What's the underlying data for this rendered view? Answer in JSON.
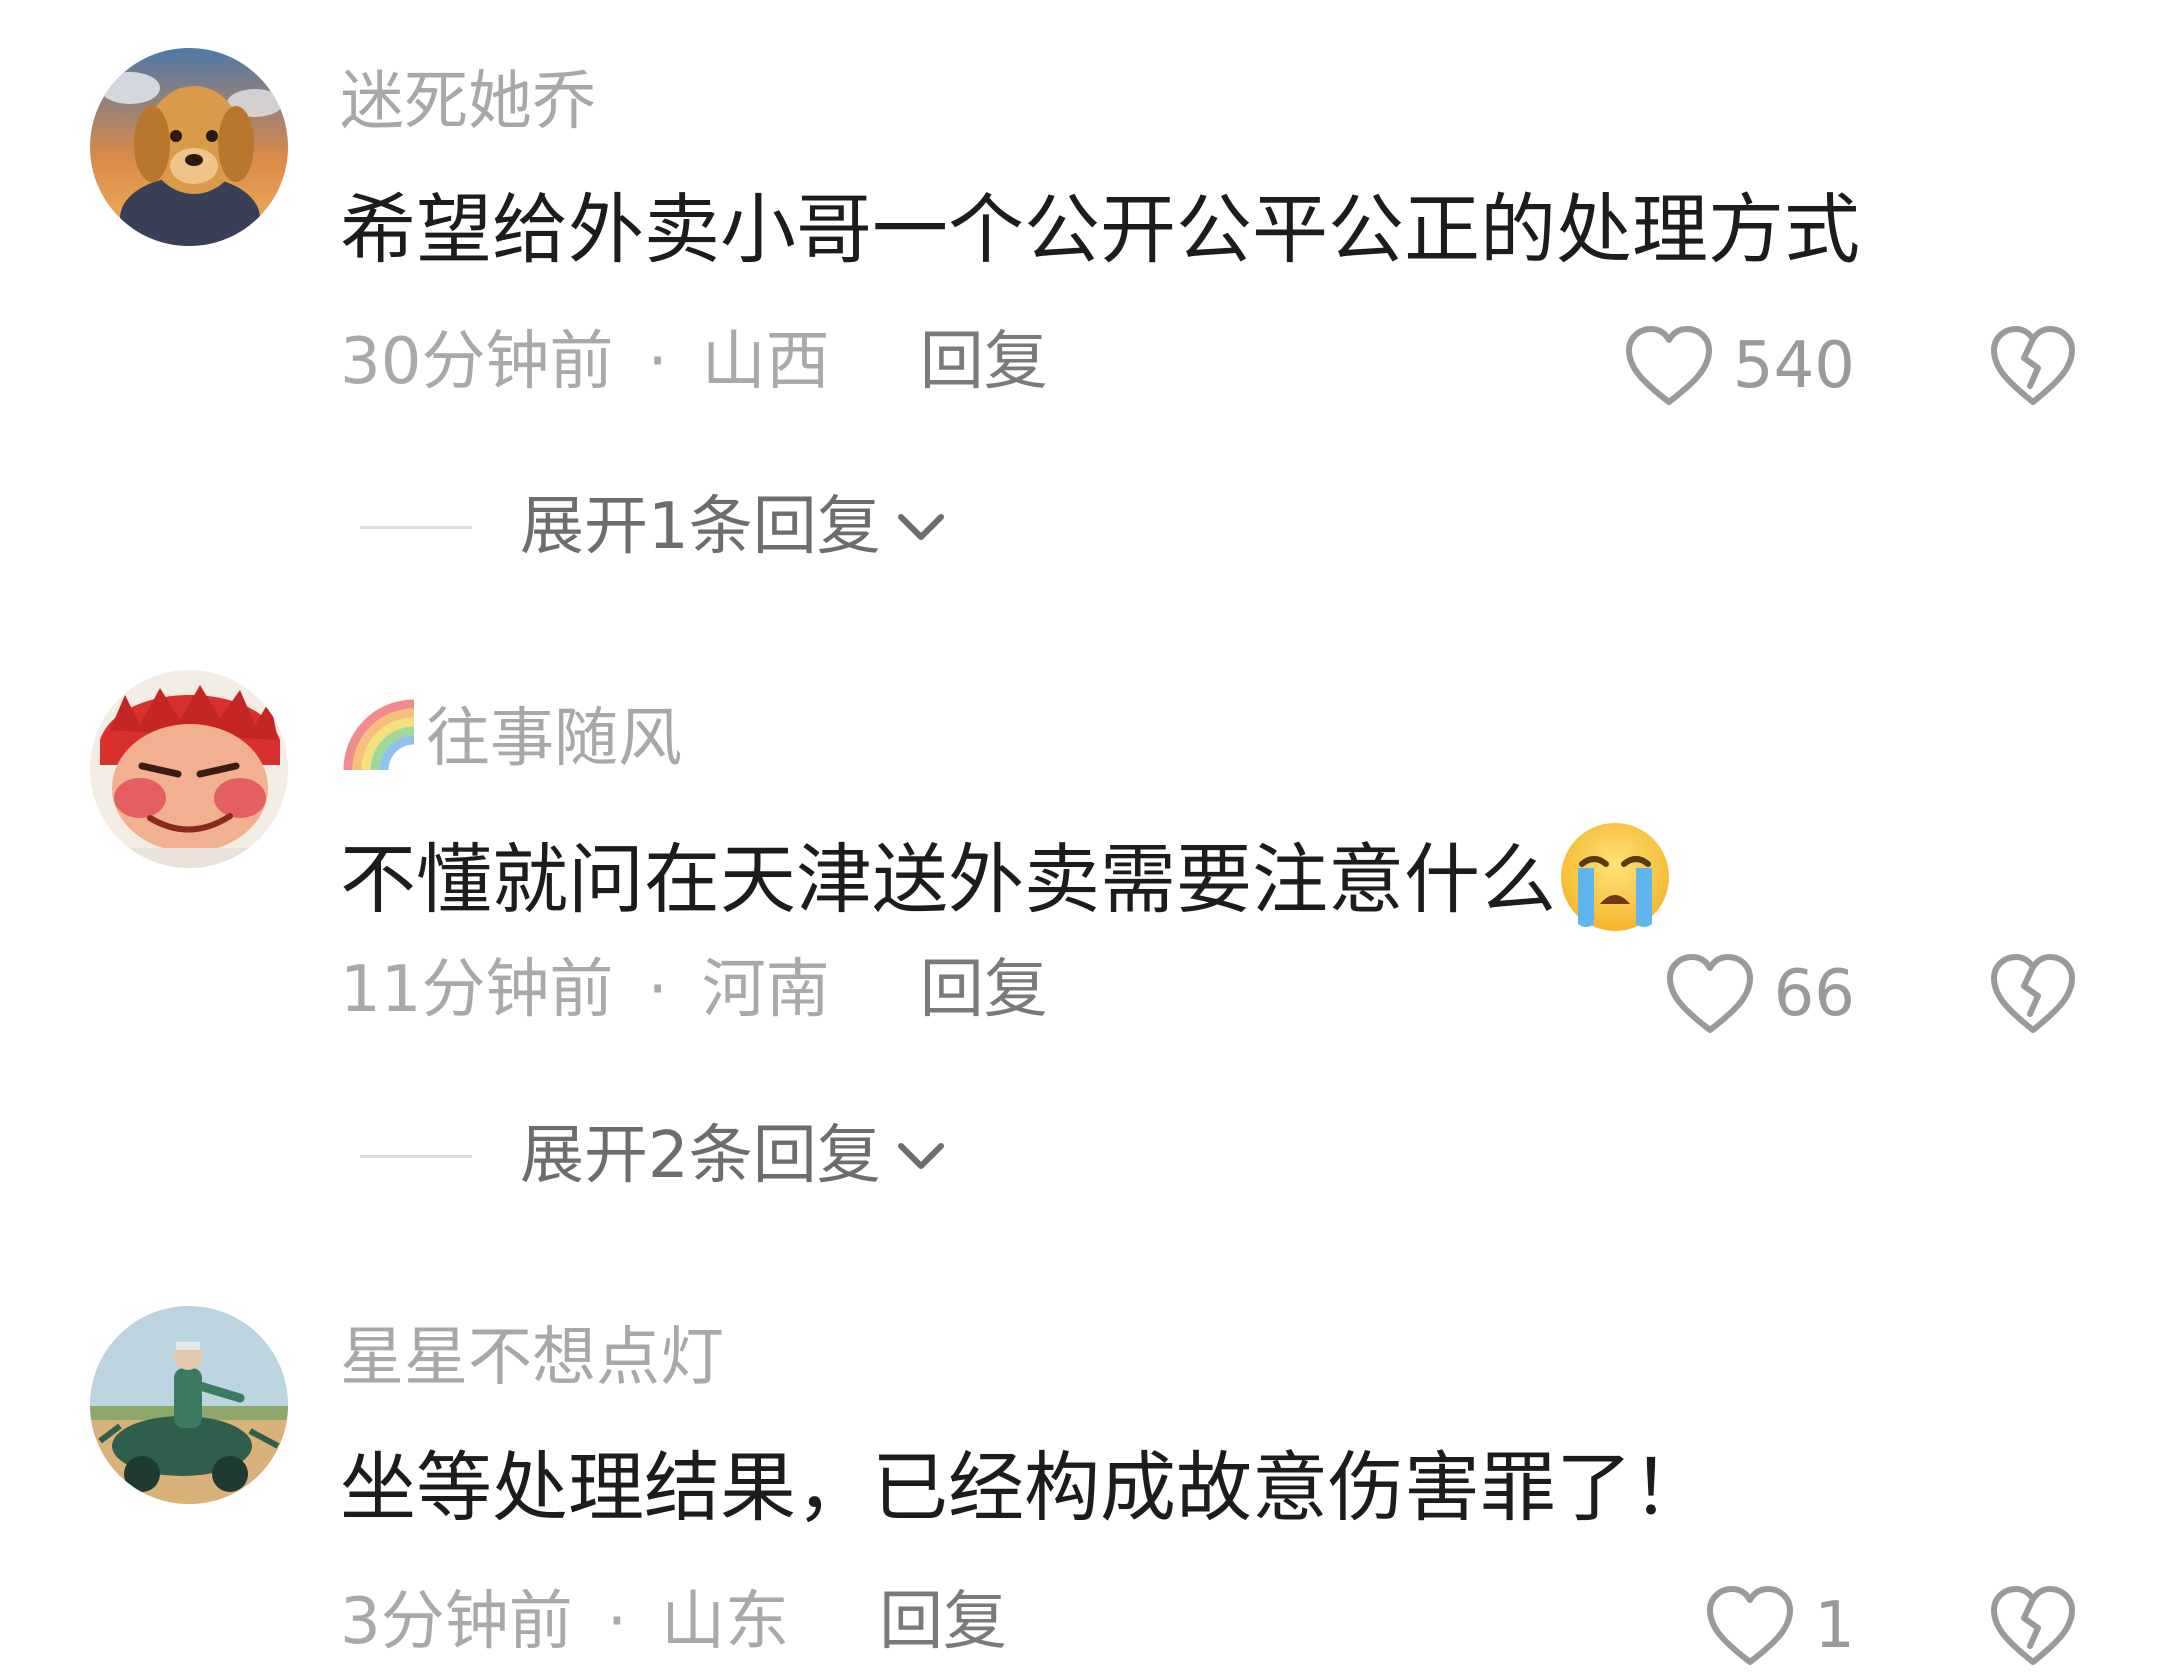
{
  "comments": [
    {
      "username": "迷死她乔",
      "text": "希望给外卖小哥一个公开公平公正的处理方式",
      "time": "30分钟前",
      "location": "山西",
      "reply_label": "回复",
      "likes": "540",
      "expand_label": "展开1条回复",
      "avatar_icon": "golden-retriever-avatar"
    },
    {
      "username": "往事随风",
      "username_badge": "rainbow-emoji",
      "text": "不懂就问在天津送外卖需要注意什么",
      "text_emoji": "loudly-crying-face-emoji",
      "time": "11分钟前",
      "location": "河南",
      "reply_label": "回复",
      "likes": "66",
      "expand_label": "展开2条回复",
      "avatar_icon": "anime-character-avatar"
    },
    {
      "username": "星星不想点灯",
      "text": "坐等处理结果，已经构成故意伤害罪了！",
      "time": "3分钟前",
      "location": "山东",
      "reply_label": "回复",
      "likes": "1",
      "avatar_icon": "figure-on-vehicle-avatar"
    }
  ],
  "separator": "·",
  "colors": {
    "background": "#ffffff",
    "username": "#a8a8a8",
    "body_text": "#1c1c1c",
    "meta_text": "#a9a9a9",
    "reply_link": "#7a7a7a",
    "icon_stroke": "#9a9a9a"
  }
}
